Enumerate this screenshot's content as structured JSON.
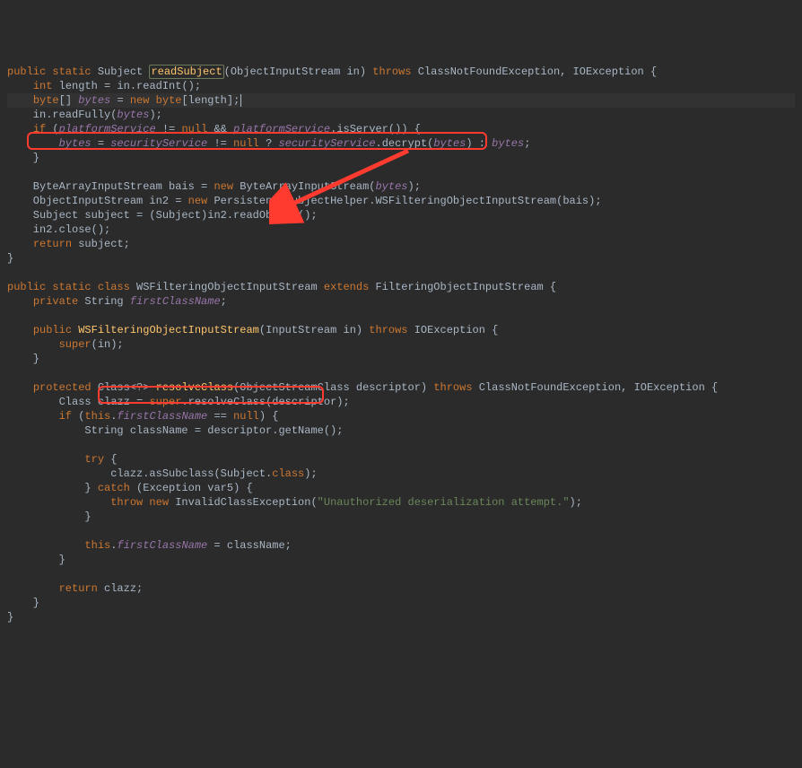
{
  "line1": {
    "a": "public static ",
    "b": "Subject ",
    "c": "readSubject",
    "d": "(ObjectInputStream in) ",
    "e": "throws ",
    "f": "ClassNotFoundException, IOException {"
  },
  "line2": {
    "a": "    ",
    "b": "int ",
    "c": "length = in.readInt();"
  },
  "line3": {
    "a": "    ",
    "b": "byte",
    "c": "[] ",
    "d": "bytes",
    "e": " = ",
    "f": "new byte",
    "g": "[length];"
  },
  "line4": {
    "a": "    in.readFully(",
    "b": "bytes",
    "c": ");"
  },
  "line5": {
    "a": "    ",
    "b": "if ",
    "c": "(",
    "d": "platformService",
    "e": " != ",
    "f": "null ",
    "g": "&& ",
    "h": "platformService",
    "i": ".isServer()) {"
  },
  "line6": {
    "a": "        ",
    "b": "bytes",
    "c": " = ",
    "d": "securityService",
    "e": " != ",
    "f": "null ",
    "g": "? ",
    "h": "securityService",
    "i": ".decrypt(",
    "j": "bytes",
    "k": ") : ",
    "l": "bytes",
    "m": ";"
  },
  "line7": "    }",
  "blank": "",
  "line8": {
    "a": "    ByteArrayInputStream bais = ",
    "b": "new ",
    "c": "ByteArrayInputStream(",
    "d": "bytes",
    "e": ");"
  },
  "line9": {
    "a": "    ObjectInputStream in2 = ",
    "b": "new ",
    "c": "PersistenceSubjectHelper.WSFilteringObjectInputStream(bais);"
  },
  "line10": {
    "a": "    Subject subject = (Subject)in2.readObject();"
  },
  "line11": {
    "a": "    in2.close();"
  },
  "line12": {
    "a": "    ",
    "b": "return ",
    "c": "subject;"
  },
  "line13": "}",
  "line14": {
    "a": "public static class ",
    "b": "WSFilteringObjectInputStream ",
    "c": "extends ",
    "d": "FilteringObjectInputStream {"
  },
  "line15": {
    "a": "    ",
    "b": "private ",
    "c": "String ",
    "d": "firstClassName",
    "e": ";"
  },
  "line16": {
    "a": "    ",
    "b": "public ",
    "c": "WSFilteringObjectInputStream",
    "d": "(InputStream in) ",
    "e": "throws ",
    "f": "IOException {"
  },
  "line17": {
    "a": "        ",
    "b": "super",
    "c": "(in);"
  },
  "line18": "    }",
  "line19": {
    "a": "    ",
    "b": "protected ",
    "c": "Class<?> ",
    "d": "resolveClass",
    "e": "(ObjectStreamClass descriptor) ",
    "f": "throws ",
    "g": "ClassNotFoundException, IOException {"
  },
  "line20": {
    "a": "        Class clazz = ",
    "b": "super",
    "c": ".resolveClass(descriptor);"
  },
  "line21": {
    "a": "        ",
    "b": "if ",
    "c": "(",
    "d": "this",
    "e": ".",
    "f": "firstClassName",
    "g": " == ",
    "h": "null",
    "i": ") {"
  },
  "line22": {
    "a": "            String className = descriptor.getName();"
  },
  "line23": {
    "a": "            ",
    "b": "try ",
    "c": "{"
  },
  "line24": {
    "a": "                clazz.asSubclass(Subject.",
    "b": "class",
    "c": ");"
  },
  "line25": {
    "a": "            } ",
    "b": "catch ",
    "c": "(Exception var5) {"
  },
  "line26": {
    "a": "                ",
    "b": "throw new ",
    "c": "InvalidClassException(",
    "d": "\"Unauthorized deserialization attempt.\"",
    "e": ");"
  },
  "line27": "            }",
  "line28": {
    "a": "            ",
    "b": "this",
    "c": ".",
    "d": "firstClassName",
    "e": " = className;"
  },
  "line29": "        }",
  "line30": {
    "a": "        ",
    "b": "return ",
    "c": "clazz;"
  },
  "line31": "    }",
  "line32": "}"
}
